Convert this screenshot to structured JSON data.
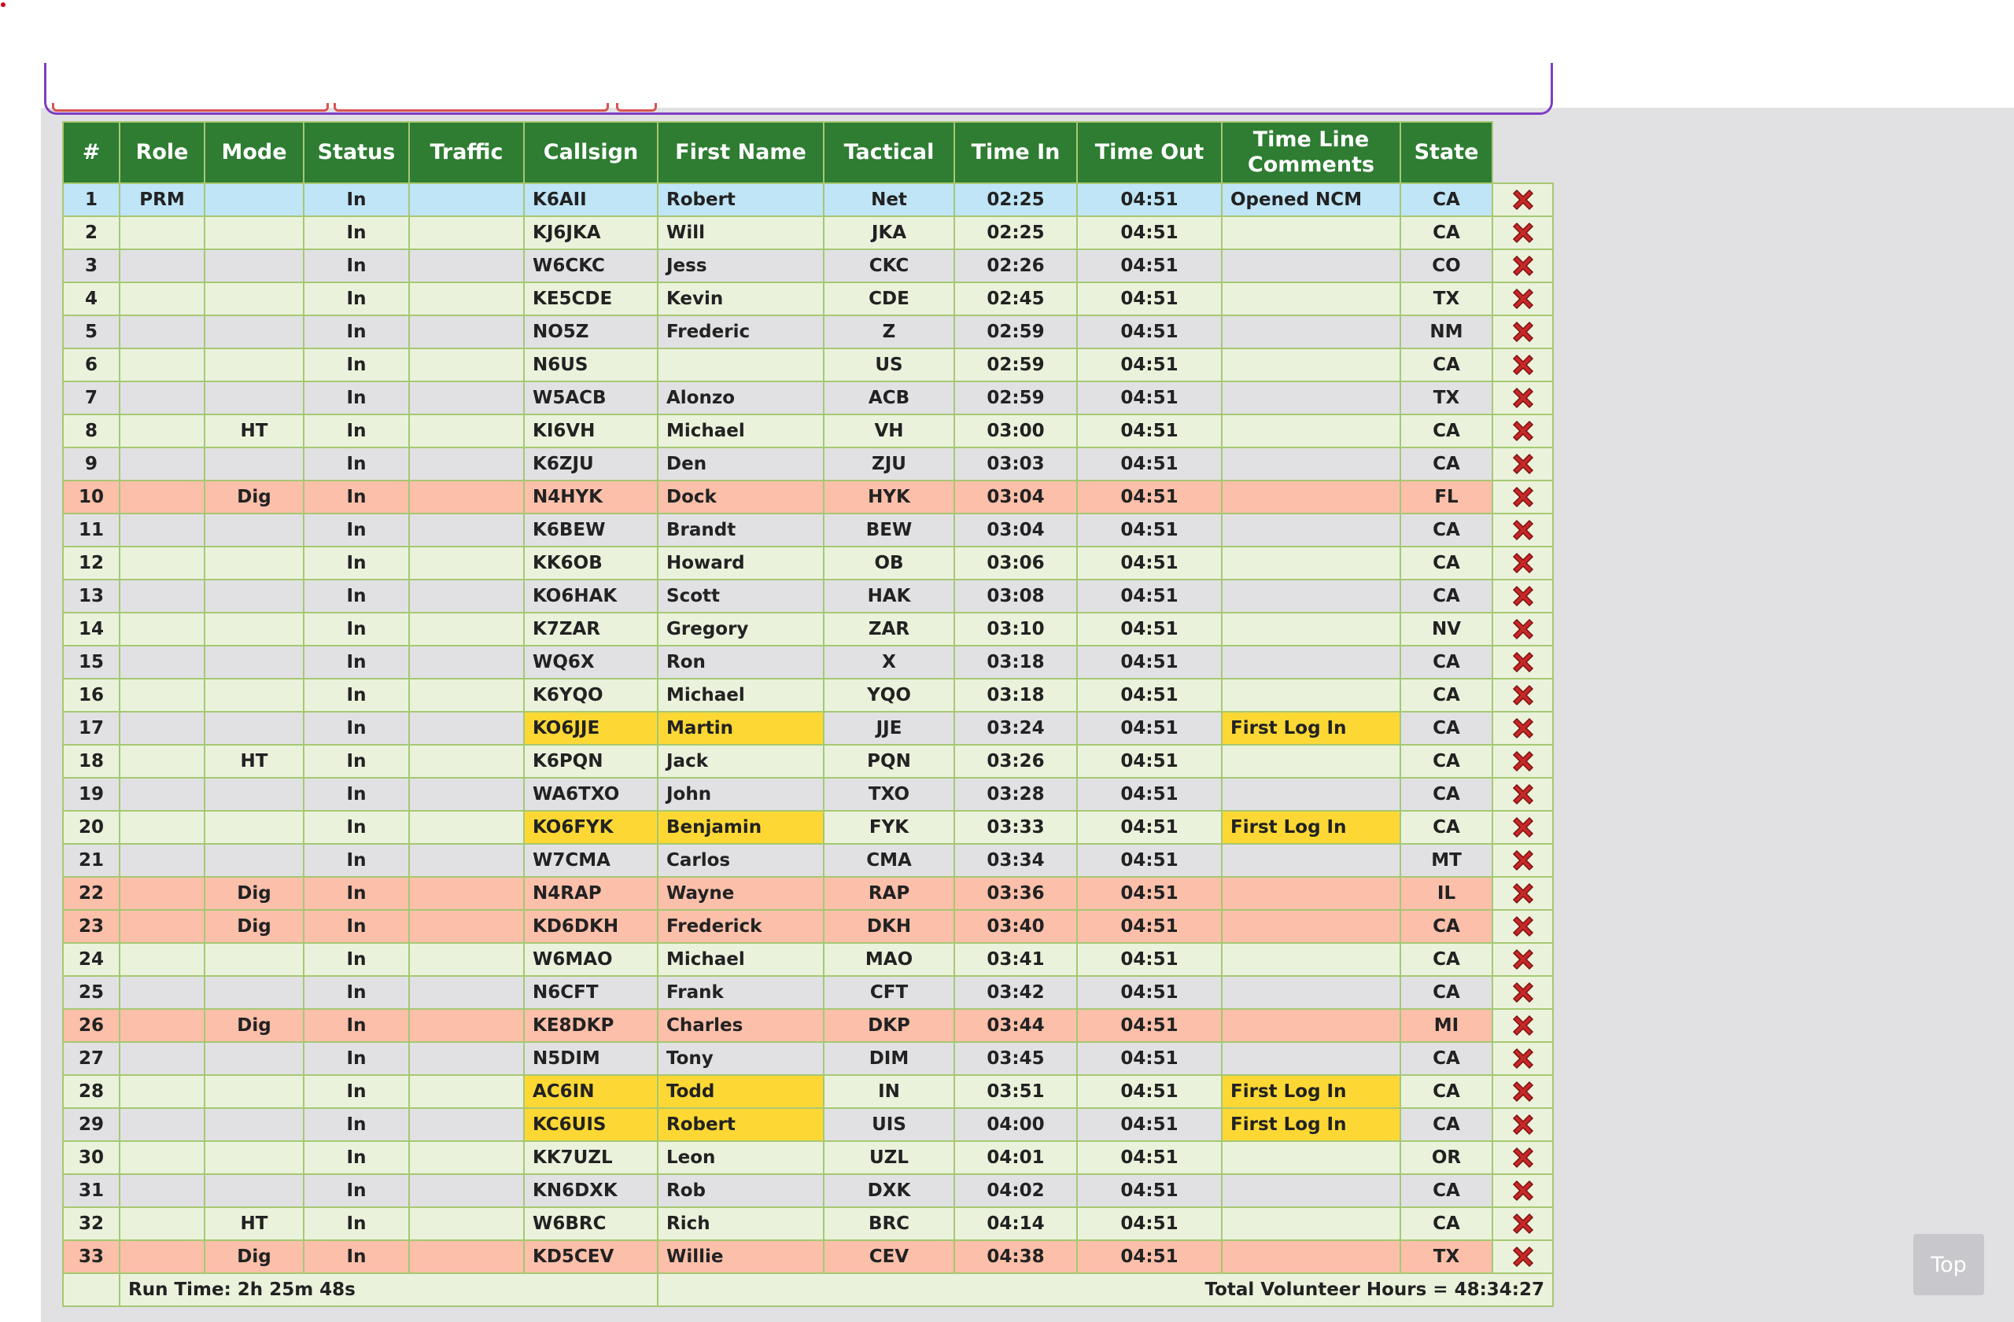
{
  "table": {
    "headers": [
      "#",
      "Role",
      "Mode",
      "Status",
      "Traffic",
      "Callsign",
      "First Name",
      "Tactical",
      "Time In",
      "Time Out",
      "Time Line Comments",
      "State"
    ],
    "rows": [
      {
        "num": "1",
        "role": "PRM",
        "mode": "",
        "status": "In",
        "traffic": "",
        "callsign": "K6AII",
        "first_name": "Robert",
        "tactical": "Net",
        "time_in": "02:25",
        "time_out": "04:51",
        "comments": "Opened NCM",
        "state": "CA",
        "style": "primary",
        "newbie": false
      },
      {
        "num": "2",
        "role": "",
        "mode": "",
        "status": "In",
        "traffic": "",
        "callsign": "KJ6JKA",
        "first_name": "Will",
        "tactical": "JKA",
        "time_in": "02:25",
        "time_out": "04:51",
        "comments": "",
        "state": "CA",
        "style": "odd",
        "newbie": false
      },
      {
        "num": "3",
        "role": "",
        "mode": "",
        "status": "In",
        "traffic": "",
        "callsign": "W6CKC",
        "first_name": "Jess",
        "tactical": "CKC",
        "time_in": "02:26",
        "time_out": "04:51",
        "comments": "",
        "state": "CO",
        "style": "even",
        "newbie": false
      },
      {
        "num": "4",
        "role": "",
        "mode": "",
        "status": "In",
        "traffic": "",
        "callsign": "KE5CDE",
        "first_name": "Kevin",
        "tactical": "CDE",
        "time_in": "02:45",
        "time_out": "04:51",
        "comments": "",
        "state": "TX",
        "style": "odd",
        "newbie": false
      },
      {
        "num": "5",
        "role": "",
        "mode": "",
        "status": "In",
        "traffic": "",
        "callsign": "NO5Z",
        "first_name": "Frederic",
        "tactical": "Z",
        "time_in": "02:59",
        "time_out": "04:51",
        "comments": "",
        "state": "NM",
        "style": "even",
        "newbie": false
      },
      {
        "num": "6",
        "role": "",
        "mode": "",
        "status": "In",
        "traffic": "",
        "callsign": "N6US",
        "first_name": "",
        "tactical": "US",
        "time_in": "02:59",
        "time_out": "04:51",
        "comments": "",
        "state": "CA",
        "style": "odd",
        "newbie": false
      },
      {
        "num": "7",
        "role": "",
        "mode": "",
        "status": "In",
        "traffic": "",
        "callsign": "W5ACB",
        "first_name": "Alonzo",
        "tactical": "ACB",
        "time_in": "02:59",
        "time_out": "04:51",
        "comments": "",
        "state": "TX",
        "style": "even",
        "newbie": false
      },
      {
        "num": "8",
        "role": "",
        "mode": "HT",
        "status": "In",
        "traffic": "",
        "callsign": "KI6VH",
        "first_name": "Michael",
        "tactical": "VH",
        "time_in": "03:00",
        "time_out": "04:51",
        "comments": "",
        "state": "CA",
        "style": "odd",
        "newbie": false
      },
      {
        "num": "9",
        "role": "",
        "mode": "",
        "status": "In",
        "traffic": "",
        "callsign": "K6ZJU",
        "first_name": "Den",
        "tactical": "ZJU",
        "time_in": "03:03",
        "time_out": "04:51",
        "comments": "",
        "state": "CA",
        "style": "even",
        "newbie": false
      },
      {
        "num": "10",
        "role": "",
        "mode": "Dig",
        "status": "In",
        "traffic": "",
        "callsign": "N4HYK",
        "first_name": "Dock",
        "tactical": "HYK",
        "time_in": "03:04",
        "time_out": "04:51",
        "comments": "",
        "state": "FL",
        "style": "digital",
        "newbie": false
      },
      {
        "num": "11",
        "role": "",
        "mode": "",
        "status": "In",
        "traffic": "",
        "callsign": "K6BEW",
        "first_name": "Brandt",
        "tactical": "BEW",
        "time_in": "03:04",
        "time_out": "04:51",
        "comments": "",
        "state": "CA",
        "style": "even",
        "newbie": false
      },
      {
        "num": "12",
        "role": "",
        "mode": "",
        "status": "In",
        "traffic": "",
        "callsign": "KK6OB",
        "first_name": "Howard",
        "tactical": "OB",
        "time_in": "03:06",
        "time_out": "04:51",
        "comments": "",
        "state": "CA",
        "style": "odd",
        "newbie": false
      },
      {
        "num": "13",
        "role": "",
        "mode": "",
        "status": "In",
        "traffic": "",
        "callsign": "KO6HAK",
        "first_name": "Scott",
        "tactical": "HAK",
        "time_in": "03:08",
        "time_out": "04:51",
        "comments": "",
        "state": "CA",
        "style": "even",
        "newbie": false
      },
      {
        "num": "14",
        "role": "",
        "mode": "",
        "status": "In",
        "traffic": "",
        "callsign": "K7ZAR",
        "first_name": "Gregory",
        "tactical": "ZAR",
        "time_in": "03:10",
        "time_out": "04:51",
        "comments": "",
        "state": "NV",
        "style": "odd",
        "newbie": false
      },
      {
        "num": "15",
        "role": "",
        "mode": "",
        "status": "In",
        "traffic": "",
        "callsign": "WQ6X",
        "first_name": "Ron",
        "tactical": "X",
        "time_in": "03:18",
        "time_out": "04:51",
        "comments": "",
        "state": "CA",
        "style": "even",
        "newbie": false
      },
      {
        "num": "16",
        "role": "",
        "mode": "",
        "status": "In",
        "traffic": "",
        "callsign": "K6YQO",
        "first_name": "Michael",
        "tactical": "YQO",
        "time_in": "03:18",
        "time_out": "04:51",
        "comments": "",
        "state": "CA",
        "style": "odd",
        "newbie": false
      },
      {
        "num": "17",
        "role": "",
        "mode": "",
        "status": "In",
        "traffic": "",
        "callsign": "KO6JJE",
        "first_name": "Martin",
        "tactical": "JJE",
        "time_in": "03:24",
        "time_out": "04:51",
        "comments": "First Log In",
        "state": "CA",
        "style": "even",
        "newbie": true
      },
      {
        "num": "18",
        "role": "",
        "mode": "HT",
        "status": "In",
        "traffic": "",
        "callsign": "K6PQN",
        "first_name": "Jack",
        "tactical": "PQN",
        "time_in": "03:26",
        "time_out": "04:51",
        "comments": "",
        "state": "CA",
        "style": "odd",
        "newbie": false
      },
      {
        "num": "19",
        "role": "",
        "mode": "",
        "status": "In",
        "traffic": "",
        "callsign": "WA6TXO",
        "first_name": "John",
        "tactical": "TXO",
        "time_in": "03:28",
        "time_out": "04:51",
        "comments": "",
        "state": "CA",
        "style": "even",
        "newbie": false
      },
      {
        "num": "20",
        "role": "",
        "mode": "",
        "status": "In",
        "traffic": "",
        "callsign": "KO6FYK",
        "first_name": "Benjamin",
        "tactical": "FYK",
        "time_in": "03:33",
        "time_out": "04:51",
        "comments": "First Log In",
        "state": "CA",
        "style": "odd",
        "newbie": true
      },
      {
        "num": "21",
        "role": "",
        "mode": "",
        "status": "In",
        "traffic": "",
        "callsign": "W7CMA",
        "first_name": "Carlos",
        "tactical": "CMA",
        "time_in": "03:34",
        "time_out": "04:51",
        "comments": "",
        "state": "MT",
        "style": "even",
        "newbie": false
      },
      {
        "num": "22",
        "role": "",
        "mode": "Dig",
        "status": "In",
        "traffic": "",
        "callsign": "N4RAP",
        "first_name": "Wayne",
        "tactical": "RAP",
        "time_in": "03:36",
        "time_out": "04:51",
        "comments": "",
        "state": "IL",
        "style": "digital",
        "newbie": false
      },
      {
        "num": "23",
        "role": "",
        "mode": "Dig",
        "status": "In",
        "traffic": "",
        "callsign": "KD6DKH",
        "first_name": "Frederick",
        "tactical": "DKH",
        "time_in": "03:40",
        "time_out": "04:51",
        "comments": "",
        "state": "CA",
        "style": "digital",
        "newbie": false
      },
      {
        "num": "24",
        "role": "",
        "mode": "",
        "status": "In",
        "traffic": "",
        "callsign": "W6MAO",
        "first_name": "Michael",
        "tactical": "MAO",
        "time_in": "03:41",
        "time_out": "04:51",
        "comments": "",
        "state": "CA",
        "style": "odd",
        "newbie": false
      },
      {
        "num": "25",
        "role": "",
        "mode": "",
        "status": "In",
        "traffic": "",
        "callsign": "N6CFT",
        "first_name": "Frank",
        "tactical": "CFT",
        "time_in": "03:42",
        "time_out": "04:51",
        "comments": "",
        "state": "CA",
        "style": "even",
        "newbie": false
      },
      {
        "num": "26",
        "role": "",
        "mode": "Dig",
        "status": "In",
        "traffic": "",
        "callsign": "KE8DKP",
        "first_name": "Charles",
        "tactical": "DKP",
        "time_in": "03:44",
        "time_out": "04:51",
        "comments": "",
        "state": "MI",
        "style": "digital",
        "newbie": false
      },
      {
        "num": "27",
        "role": "",
        "mode": "",
        "status": "In",
        "traffic": "",
        "callsign": "N5DIM",
        "first_name": "Tony",
        "tactical": "DIM",
        "time_in": "03:45",
        "time_out": "04:51",
        "comments": "",
        "state": "CA",
        "style": "even",
        "newbie": false
      },
      {
        "num": "28",
        "role": "",
        "mode": "",
        "status": "In",
        "traffic": "",
        "callsign": "AC6IN",
        "first_name": "Todd",
        "tactical": "IN",
        "time_in": "03:51",
        "time_out": "04:51",
        "comments": "First Log In",
        "state": "CA",
        "style": "odd",
        "newbie": true
      },
      {
        "num": "29",
        "role": "",
        "mode": "",
        "status": "In",
        "traffic": "",
        "callsign": "KC6UIS",
        "first_name": "Robert",
        "tactical": "UIS",
        "time_in": "04:00",
        "time_out": "04:51",
        "comments": "First Log In",
        "state": "CA",
        "style": "even",
        "newbie": true
      },
      {
        "num": "30",
        "role": "",
        "mode": "",
        "status": "In",
        "traffic": "",
        "callsign": "KK7UZL",
        "first_name": "Leon",
        "tactical": "UZL",
        "time_in": "04:01",
        "time_out": "04:51",
        "comments": "",
        "state": "OR",
        "style": "odd",
        "newbie": false
      },
      {
        "num": "31",
        "role": "",
        "mode": "",
        "status": "In",
        "traffic": "",
        "callsign": "KN6DXK",
        "first_name": "Rob",
        "tactical": "DXK",
        "time_in": "04:02",
        "time_out": "04:51",
        "comments": "",
        "state": "CA",
        "style": "even",
        "newbie": false
      },
      {
        "num": "32",
        "role": "",
        "mode": "HT",
        "status": "In",
        "traffic": "",
        "callsign": "W6BRC",
        "first_name": "Rich",
        "tactical": "BRC",
        "time_in": "04:14",
        "time_out": "04:51",
        "comments": "",
        "state": "CA",
        "style": "odd",
        "newbie": false
      },
      {
        "num": "33",
        "role": "",
        "mode": "Dig",
        "status": "In",
        "traffic": "",
        "callsign": "KD5CEV",
        "first_name": "Willie",
        "tactical": "CEV",
        "time_in": "04:38",
        "time_out": "04:51",
        "comments": "",
        "state": "TX",
        "style": "digital",
        "newbie": false
      }
    ]
  },
  "footer": {
    "run_time": "Run Time: 2h 25m 48s",
    "total_hours": "Total Volunteer Hours = 48:34:27"
  },
  "top_button": "Top",
  "icons": {
    "delete": "delete-x-icon"
  },
  "colors": {
    "header_bg": "#2e7d32",
    "primary_row": "#bfe5f7",
    "digital_row": "#fbbfaa",
    "first_log_in": "#fdd835",
    "odd_row": "#eaf2dc",
    "even_row": "#e1e1e4",
    "delete_icon": "#c62828",
    "frame": "#7e3fc1"
  }
}
